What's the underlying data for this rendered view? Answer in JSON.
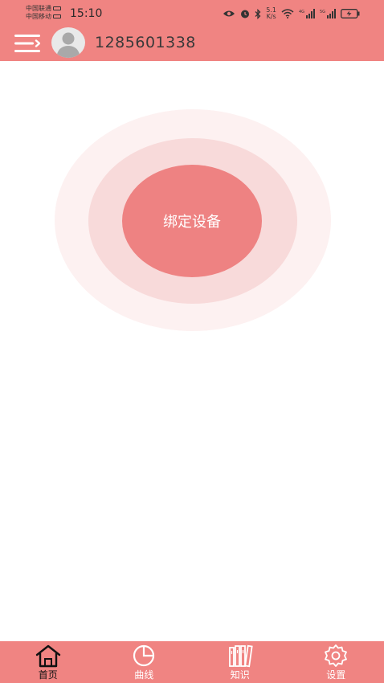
{
  "status_bar": {
    "carrier_1": "中国联通",
    "carrier_2": "中国移动",
    "time": "15:10",
    "net_speed_value": "5.1",
    "net_speed_unit": "K/s",
    "signal_1_tag": "4G",
    "signal_2_tag": "5G"
  },
  "header": {
    "menu_icon": "menu-icon",
    "avatar_icon": "user-avatar-icon",
    "username": "1285601338"
  },
  "main": {
    "bind_button_label": "绑定设备"
  },
  "bottom_nav": {
    "items": [
      {
        "label": "首页",
        "icon": "home-icon",
        "active": true
      },
      {
        "label": "曲线",
        "icon": "pie-chart-icon",
        "active": false
      },
      {
        "label": "知识",
        "icon": "books-icon",
        "active": false
      },
      {
        "label": "设置",
        "icon": "gear-icon",
        "active": false
      }
    ]
  },
  "colors": {
    "primary": "#f08482",
    "ring_outer": "#fdf1f1",
    "ring_mid": "#f8dada",
    "button": "#ee8282"
  }
}
